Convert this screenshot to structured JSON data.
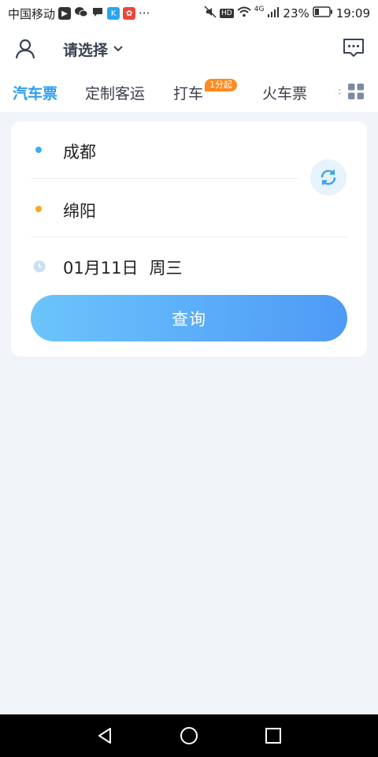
{
  "status_bar": {
    "carrier": "中国移动",
    "more": "···",
    "hd": "HD",
    "network": "4G",
    "battery": "23%",
    "time": "19:09"
  },
  "header": {
    "location": "请选择"
  },
  "tabs": [
    {
      "label": "汽车票",
      "active": true
    },
    {
      "label": "定制客运",
      "active": false
    },
    {
      "label": "打车",
      "active": false
    },
    {
      "label": "火车票",
      "active": false
    },
    {
      "label": "扌",
      "active": false
    }
  ],
  "tab_badge": "1分起",
  "search": {
    "from_city": "成都",
    "to_city": "绵阳",
    "date": "01月11日",
    "weekday": "周三",
    "query_label": "查询"
  },
  "colors": {
    "accent": "#2d9cf0",
    "from_dot": "#3aaef0",
    "to_dot": "#f5a623",
    "badge": "#ff8a1f"
  }
}
